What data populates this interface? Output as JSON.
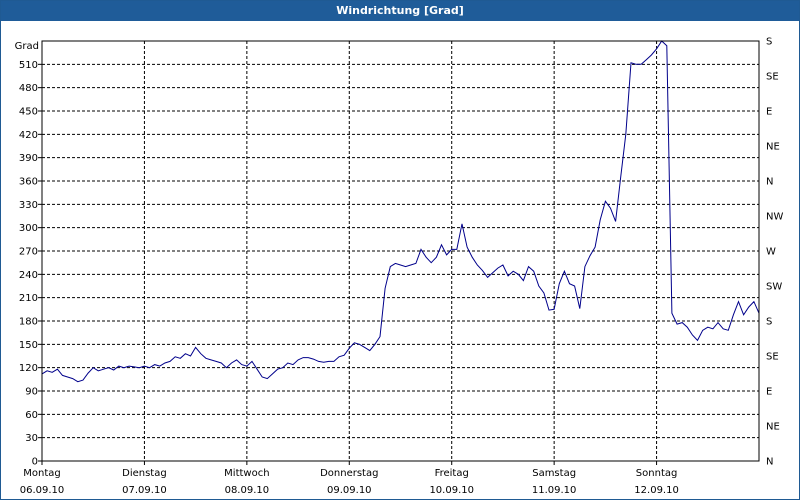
{
  "window": {
    "title": "Windrichtung [Grad]"
  },
  "colors": {
    "title_bar": "#1f5c99",
    "title_text": "#ffffff",
    "series_line": "#00008b",
    "grid": "#000000",
    "background": "#ffffff"
  },
  "chart_data": {
    "type": "line",
    "title": "Windrichtung [Grad]",
    "ylabel": "Grad",
    "ylim": [
      0,
      540
    ],
    "yticks": [
      0,
      30,
      60,
      90,
      120,
      150,
      180,
      210,
      240,
      270,
      300,
      330,
      360,
      390,
      420,
      450,
      480,
      510
    ],
    "right_axis_labels": [
      "N",
      "NE",
      "E",
      "SE",
      "S",
      "SW",
      "W",
      "NW",
      "N",
      "NE",
      "E",
      "SE",
      "S"
    ],
    "right_axis_values": [
      0,
      45,
      90,
      135,
      180,
      225,
      270,
      315,
      360,
      405,
      450,
      495,
      540
    ],
    "xlim": [
      0,
      7
    ],
    "x_categories": [
      {
        "day": "Montag",
        "date": "06.09.10"
      },
      {
        "day": "Dienstag",
        "date": "07.09.10"
      },
      {
        "day": "Mittwoch",
        "date": "08.09.10"
      },
      {
        "day": "Donnerstag",
        "date": "09.09.10"
      },
      {
        "day": "Freitag",
        "date": "10.09.10"
      },
      {
        "day": "Samstag",
        "date": "11.09.10"
      },
      {
        "day": "Sonntag",
        "date": "12.09.10"
      }
    ],
    "grid": true,
    "series": [
      {
        "values": [
          [
            0.0,
            112
          ],
          [
            0.05,
            116
          ],
          [
            0.1,
            114
          ],
          [
            0.15,
            118
          ],
          [
            0.2,
            110
          ],
          [
            0.25,
            108
          ],
          [
            0.3,
            106
          ],
          [
            0.35,
            102
          ],
          [
            0.4,
            104
          ],
          [
            0.45,
            113
          ],
          [
            0.5,
            120
          ],
          [
            0.55,
            116
          ],
          [
            0.6,
            118
          ],
          [
            0.65,
            120
          ],
          [
            0.7,
            117
          ],
          [
            0.75,
            122
          ],
          [
            0.8,
            120
          ],
          [
            0.85,
            122
          ],
          [
            0.9,
            121
          ],
          [
            0.95,
            120
          ],
          [
            1.0,
            122
          ],
          [
            1.05,
            120
          ],
          [
            1.1,
            124
          ],
          [
            1.15,
            122
          ],
          [
            1.2,
            126
          ],
          [
            1.25,
            128
          ],
          [
            1.3,
            134
          ],
          [
            1.35,
            132
          ],
          [
            1.4,
            138
          ],
          [
            1.45,
            135
          ],
          [
            1.5,
            146
          ],
          [
            1.55,
            138
          ],
          [
            1.6,
            132
          ],
          [
            1.65,
            130
          ],
          [
            1.7,
            128
          ],
          [
            1.75,
            126
          ],
          [
            1.8,
            120
          ],
          [
            1.85,
            126
          ],
          [
            1.9,
            130
          ],
          [
            1.95,
            124
          ],
          [
            2.0,
            122
          ],
          [
            2.05,
            128
          ],
          [
            2.1,
            118
          ],
          [
            2.15,
            108
          ],
          [
            2.2,
            106
          ],
          [
            2.25,
            112
          ],
          [
            2.3,
            118
          ],
          [
            2.35,
            120
          ],
          [
            2.4,
            126
          ],
          [
            2.45,
            124
          ],
          [
            2.5,
            130
          ],
          [
            2.55,
            133
          ],
          [
            2.6,
            133
          ],
          [
            2.65,
            131
          ],
          [
            2.7,
            128
          ],
          [
            2.75,
            127
          ],
          [
            2.8,
            128
          ],
          [
            2.85,
            128
          ],
          [
            2.9,
            134
          ],
          [
            2.95,
            136
          ],
          [
            3.0,
            145
          ],
          [
            3.05,
            152
          ],
          [
            3.1,
            150
          ],
          [
            3.15,
            146
          ],
          [
            3.2,
            142
          ],
          [
            3.25,
            150
          ],
          [
            3.3,
            160
          ],
          [
            3.35,
            222
          ],
          [
            3.4,
            250
          ],
          [
            3.45,
            254
          ],
          [
            3.5,
            252
          ],
          [
            3.55,
            250
          ],
          [
            3.6,
            252
          ],
          [
            3.65,
            254
          ],
          [
            3.7,
            272
          ],
          [
            3.75,
            262
          ],
          [
            3.8,
            255
          ],
          [
            3.85,
            262
          ],
          [
            3.9,
            278
          ],
          [
            3.95,
            265
          ],
          [
            4.0,
            272
          ],
          [
            4.05,
            272
          ],
          [
            4.1,
            305
          ],
          [
            4.15,
            275
          ],
          [
            4.2,
            262
          ],
          [
            4.25,
            252
          ],
          [
            4.3,
            245
          ],
          [
            4.35,
            236
          ],
          [
            4.4,
            242
          ],
          [
            4.45,
            248
          ],
          [
            4.5,
            252
          ],
          [
            4.55,
            238
          ],
          [
            4.6,
            244
          ],
          [
            4.65,
            240
          ],
          [
            4.7,
            232
          ],
          [
            4.75,
            250
          ],
          [
            4.8,
            244
          ],
          [
            4.85,
            225
          ],
          [
            4.9,
            216
          ],
          [
            4.95,
            194
          ],
          [
            5.0,
            195
          ],
          [
            5.05,
            228
          ],
          [
            5.1,
            244
          ],
          [
            5.15,
            228
          ],
          [
            5.2,
            225
          ],
          [
            5.25,
            196
          ],
          [
            5.3,
            250
          ],
          [
            5.35,
            264
          ],
          [
            5.4,
            275
          ],
          [
            5.45,
            310
          ],
          [
            5.5,
            334
          ],
          [
            5.55,
            325
          ],
          [
            5.6,
            308
          ],
          [
            5.65,
            365
          ],
          [
            5.7,
            420
          ],
          [
            5.75,
            512
          ],
          [
            5.8,
            510
          ],
          [
            5.85,
            510
          ],
          [
            5.9,
            516
          ],
          [
            5.95,
            522
          ],
          [
            6.0,
            530
          ],
          [
            6.05,
            540
          ],
          [
            6.1,
            534
          ],
          [
            6.15,
            190
          ],
          [
            6.2,
            176
          ],
          [
            6.25,
            178
          ],
          [
            6.3,
            172
          ],
          [
            6.35,
            162
          ],
          [
            6.4,
            155
          ],
          [
            6.45,
            168
          ],
          [
            6.5,
            172
          ],
          [
            6.55,
            170
          ],
          [
            6.6,
            178
          ],
          [
            6.65,
            170
          ],
          [
            6.7,
            168
          ],
          [
            6.75,
            188
          ],
          [
            6.8,
            205
          ],
          [
            6.85,
            188
          ],
          [
            6.9,
            198
          ],
          [
            6.95,
            205
          ],
          [
            7.0,
            190
          ]
        ]
      }
    ]
  }
}
